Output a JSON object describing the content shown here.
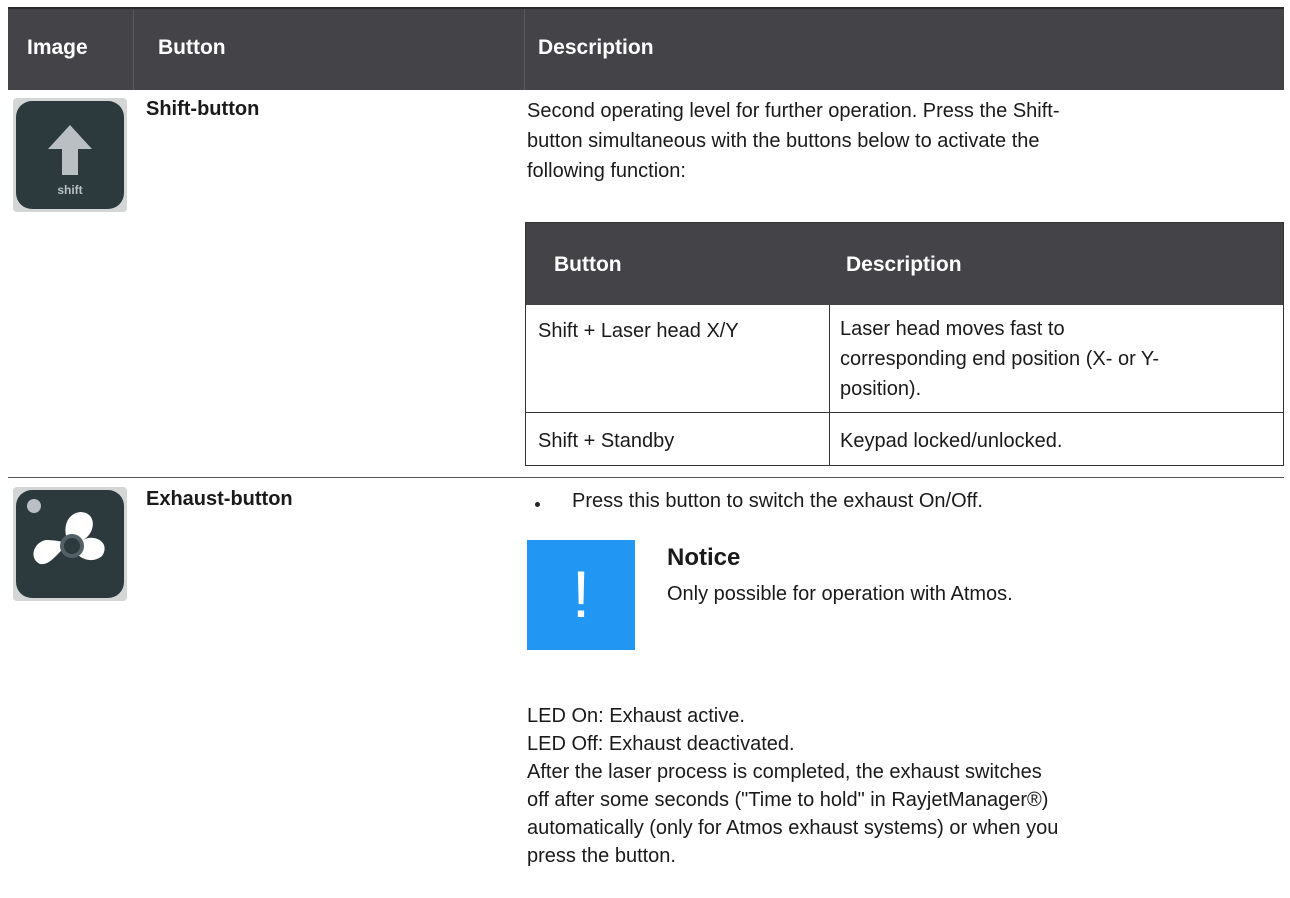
{
  "header": {
    "image": "Image",
    "button": "Button",
    "description": "Description"
  },
  "rows": [
    {
      "icon": "shift-icon",
      "icon_label": "shift",
      "name": "Shift-button",
      "description_lines": [
        "Second operating level for further operation. Press the Shift-",
        "button simultaneous with the buttons below to activate the",
        "following function:"
      ],
      "subtable": {
        "headers": [
          "Button",
          "Description"
        ],
        "rows": [
          {
            "button": "Shift + Laser head X/Y",
            "description_lines": [
              "Laser head moves fast to",
              "corresponding end position (X- or Y-",
              "position)."
            ]
          },
          {
            "button": "Shift + Standby",
            "description_lines": [
              "Keypad locked/unlocked."
            ]
          }
        ]
      }
    },
    {
      "icon": "fan-icon",
      "name": "Exhaust-button",
      "bullet": "Press this button to switch the exhaust On/Off.",
      "notice": {
        "symbol": "!",
        "title": "Notice",
        "text": "Only possible for operation with Atmos."
      },
      "paragraph_lines": [
        "LED On: Exhaust active.",
        "LED Off: Exhaust deactivated.",
        "After the laser process is completed, the exhaust switches",
        "off after some seconds (\"Time to hold\" in RayjetManager®)",
        "automatically (only for Atmos exhaust systems) or when you",
        "press the button."
      ]
    }
  ],
  "colors": {
    "header_bg": "#444448",
    "icon_bg": "#2c3a3e",
    "notice_blue": "#2196f3"
  }
}
